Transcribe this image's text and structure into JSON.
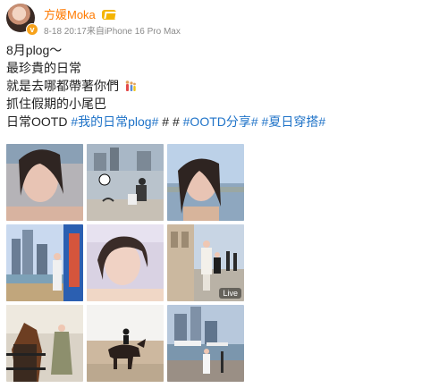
{
  "author": {
    "name": "方媛Moka",
    "meta": "8-18 20:17来自iPhone 16 Pro Max",
    "avatar_icon": "profile-avatar",
    "verify_icon": "orange-verified-badge",
    "vip_icon": "crown-vip-badge"
  },
  "post": {
    "lines": [
      "8月plog～",
      "最珍貴的日常",
      "就是去哪都帶著你們",
      "抓住假期的小尾巴"
    ],
    "emoji": "family-emoji",
    "tags_prefix": "日常OOTD",
    "tags": [
      "#我的日常plog#",
      "# #",
      "#OOTD分享#",
      "#夏日穿搭#"
    ]
  },
  "photos": [
    {
      "name": "selfie-woman-city-background"
    },
    {
      "name": "marina-with-stickers"
    },
    {
      "name": "selfie-woman-sky-waterfront"
    },
    {
      "name": "waterfront-mother-child-walk"
    },
    {
      "name": "selfie-soft-light"
    },
    {
      "name": "street-outfit-photo",
      "badge": "Live"
    },
    {
      "name": "horse-riding-stable"
    },
    {
      "name": "child-horseback-arena"
    },
    {
      "name": "harbor-pier-woman"
    }
  ],
  "colors": {
    "accent_orange": "#ff7a00",
    "tag_blue": "#1f73c8",
    "meta_gray": "#8a8a8a"
  }
}
